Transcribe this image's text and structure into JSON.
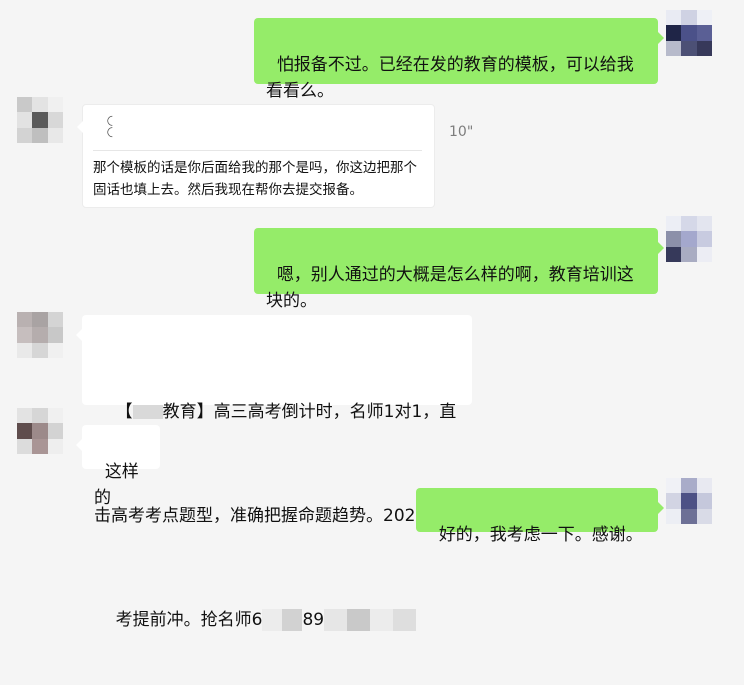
{
  "messages": [
    {
      "side": "right",
      "type": "text",
      "text": "怕报备不过。已经在发的教育的模板，可以给我\n看看么。"
    },
    {
      "side": "left",
      "type": "voice",
      "duration": "10\"",
      "transcript": "那个模板的话是你后面给我的那个是吗，你这边把那个固话也填上去。然后我现在帮你去提交报备。"
    },
    {
      "side": "right",
      "type": "text",
      "text": "嗯，别人通过的大概是怎么样的啊，教育培训这\n块的。"
    },
    {
      "side": "left",
      "type": "template",
      "bracket_open": "【",
      "brand_suffix": "教育】高三高考倒计时，名师1对1，直",
      "line2": "击高考考点题型，准确把握命题趋势。2020高",
      "line3_prefix": "考提前冲。抢名师6",
      "line3_mid": "89"
    },
    {
      "side": "left",
      "type": "text",
      "text": "这样的"
    },
    {
      "side": "right",
      "type": "text",
      "text": "好的，我考虑一下。感谢。"
    }
  ],
  "colors": {
    "background": "#f5f5f5",
    "sent_bubble": "#95ec69",
    "received_bubble": "#ffffff"
  },
  "icons": {
    "voice": "voice-wave-icon"
  }
}
